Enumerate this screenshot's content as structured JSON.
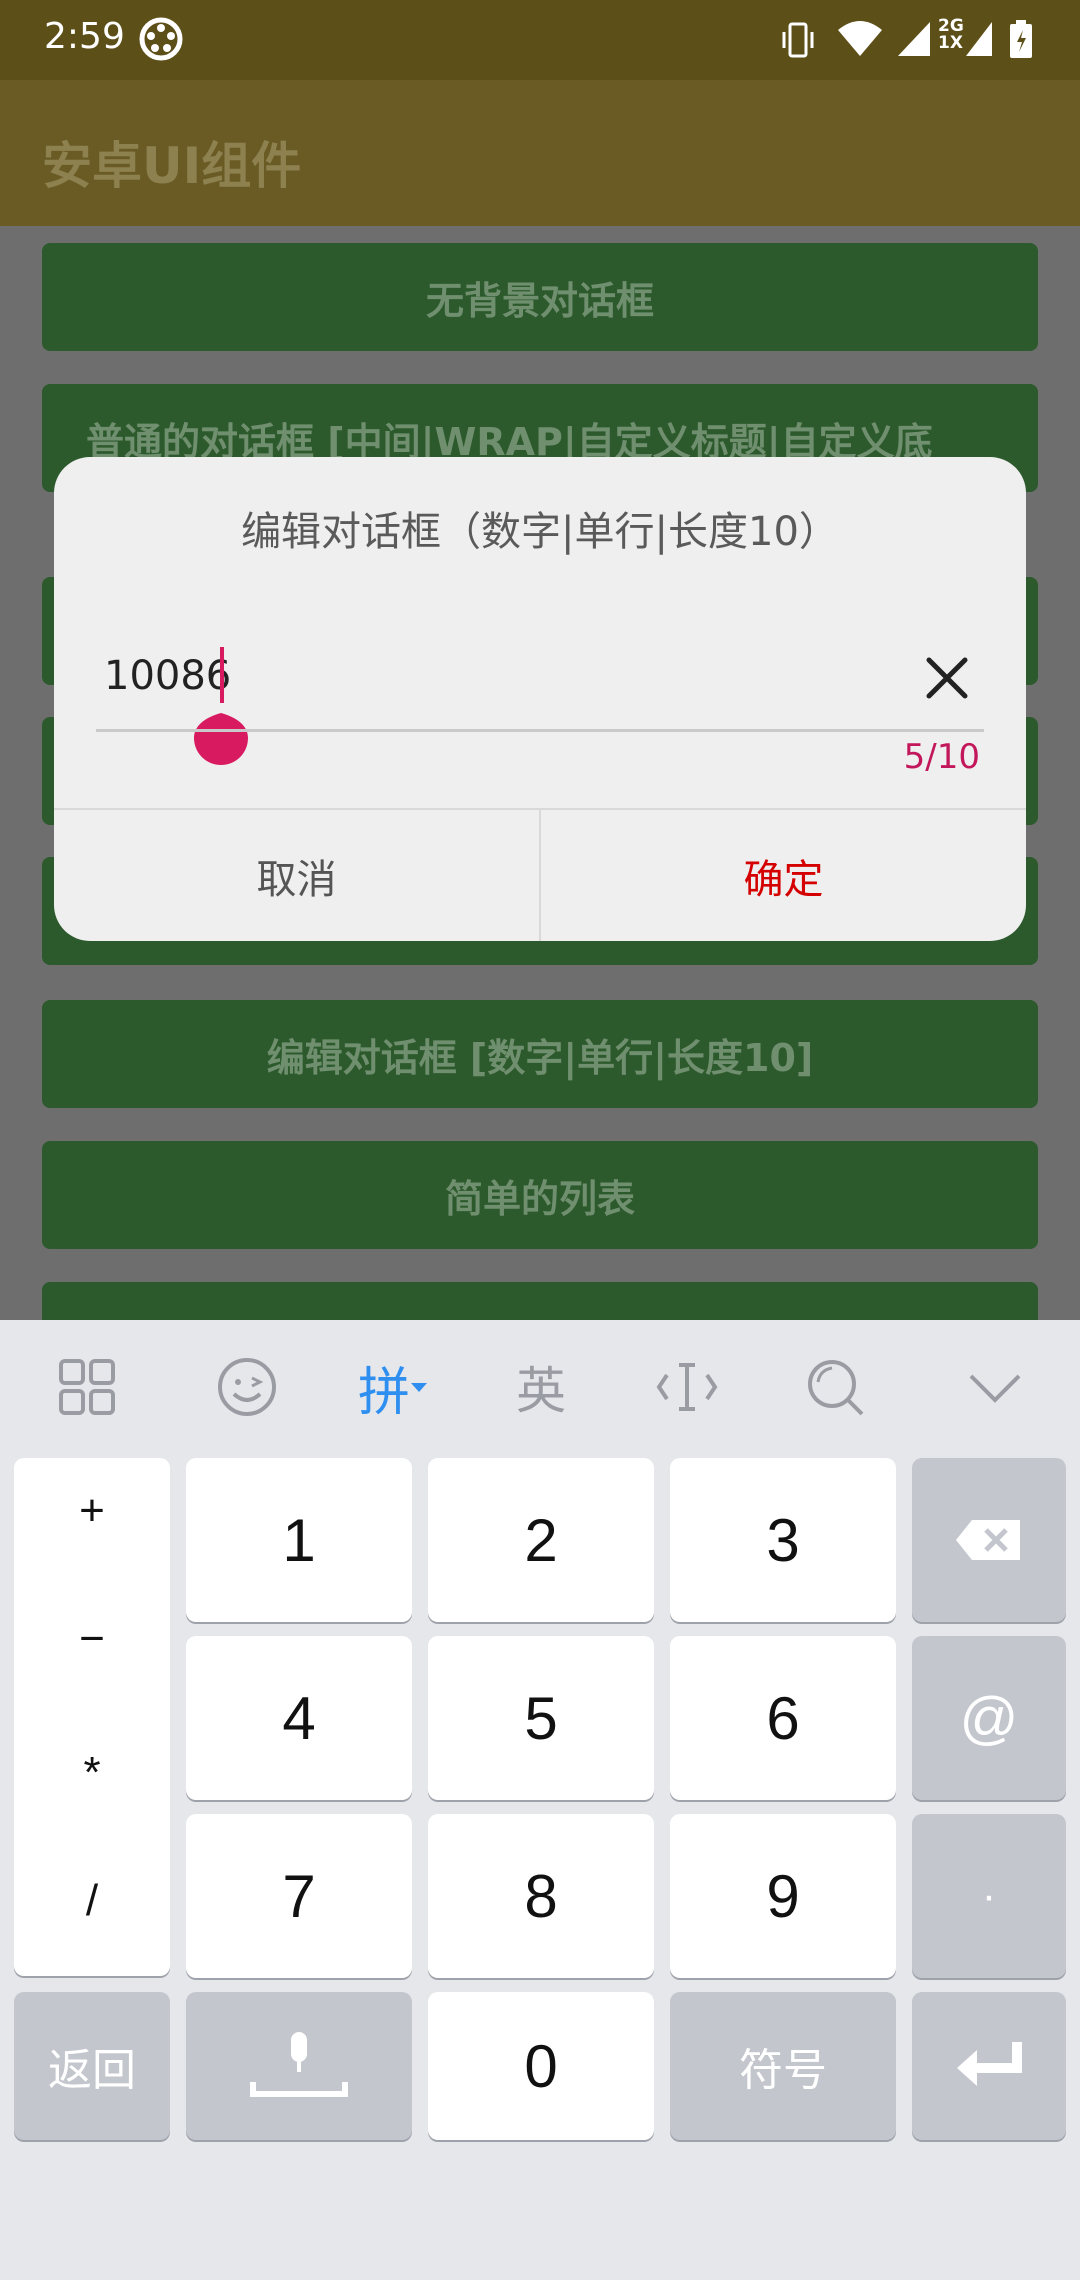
{
  "status_bar": {
    "time": "2:59",
    "network_label": "2G\n1X"
  },
  "app_bar": {
    "title": "安卓UI组件"
  },
  "list": {
    "buttons": [
      "无背景对话框",
      "普通的对话框 [中间|WRAP|自定义标题|自定义底",
      "编辑对话框 [数字|单行|长度10]",
      "简单的列表"
    ]
  },
  "dialog": {
    "title": "编辑对话框（数字|单行|长度10）",
    "input_value": "10086",
    "counter": "5/10",
    "cancel_label": "取消",
    "ok_label": "确定"
  },
  "keyboard": {
    "toolbar": {
      "pinyin": "拼",
      "english": "英"
    },
    "symbols": [
      "+",
      "−",
      "*",
      "/"
    ],
    "keys": [
      "1",
      "2",
      "3",
      "4",
      "5",
      "6",
      "7",
      "8",
      "9",
      "0"
    ],
    "at": "@",
    "dot": "·",
    "back_label": "返回",
    "symbol_label": "符号"
  },
  "colors": {
    "accent": "#d81b60",
    "ok": "#d50000",
    "toolbar_active": "#2f8ff0"
  }
}
